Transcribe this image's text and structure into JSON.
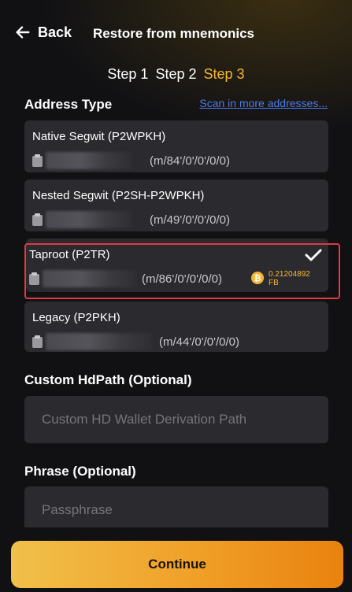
{
  "header": {
    "back_label": "Back",
    "title": "Restore from mnemonics"
  },
  "steps": [
    {
      "label": "Step 1",
      "active": false
    },
    {
      "label": "Step 2",
      "active": false
    },
    {
      "label": "Step 3",
      "active": true
    }
  ],
  "address_type": {
    "label": "Address Type",
    "scan_link": "Scan in more addresses...",
    "options": [
      {
        "name": "Native Segwit (P2WPKH)",
        "path": "(m/84'/0'/0'/0/0)",
        "selected": false
      },
      {
        "name": "Nested Segwit (P2SH-P2WPKH)",
        "path": "(m/49'/0'/0'/0/0)",
        "selected": false
      },
      {
        "name": "Taproot (P2TR)",
        "path": "(m/86'/0'/0'/0/0)",
        "selected": true,
        "balance": "0.21204892",
        "balance_unit": "FB"
      },
      {
        "name": "Legacy (P2PKH)",
        "path": "(m/44'/0'/0'/0/0)",
        "selected": false
      }
    ]
  },
  "custom_hdpath": {
    "label": "Custom HdPath (Optional)",
    "placeholder": "Custom HD Wallet Derivation Path"
  },
  "phrase": {
    "label": "Phrase (Optional)",
    "placeholder": "Passphrase"
  },
  "continue_label": "Continue",
  "colors": {
    "accent": "#f5b731",
    "link": "#4c7bea",
    "card": "#2b2a2f",
    "selection_outline": "#e0393e",
    "background": "#111114"
  }
}
